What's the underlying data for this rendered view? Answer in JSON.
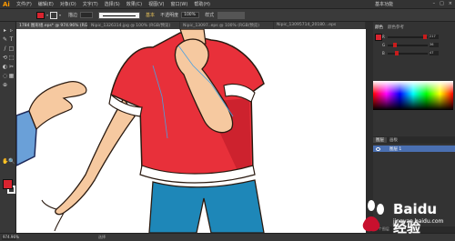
{
  "app": {
    "logo": "Ai"
  },
  "menu": {
    "items": [
      "文件(F)",
      "编辑(E)",
      "对象(O)",
      "文字(T)",
      "选择(S)",
      "效果(C)",
      "视图(V)",
      "窗口(W)",
      "帮助(H)"
    ]
  },
  "workspace": {
    "label": "基本功能"
  },
  "window_buttons": [
    "–",
    "□",
    "×"
  ],
  "control": {
    "fill_color": "#d9242f",
    "stroke_label": "描边",
    "stroke_value": "",
    "brush_label": "基本",
    "opacity_label": "不透明度",
    "opacity_value": "100%",
    "style_label": "样式"
  },
  "tabs": [
    {
      "label": "1784 图形组.eps* @ 974.96% (RGB/预览)",
      "active": true
    },
    {
      "label": "Nipic_1326314.jpg @ 100% (RGB/预览)",
      "active": false
    },
    {
      "label": "Nipic_13097..eps @ 100% (RGB/预览)",
      "active": false
    },
    {
      "label": "Nipic_13095714_20180...eps",
      "active": false
    }
  ],
  "tools": [
    "▸",
    "▹",
    "✎",
    "T",
    "/",
    "□",
    "⟲",
    "⬚",
    "◐",
    "✂",
    "◌",
    "▦",
    "⊕",
    "✋",
    "🔍"
  ],
  "toolbar_colors": {
    "fill": "#d9242f",
    "stroke": "none"
  },
  "panels": {
    "color_tabs": [
      "颜色",
      "颜色参考"
    ],
    "layer_tabs": [
      "图层",
      "画板"
    ],
    "layer_name": "图层 1",
    "color_values": [
      {
        "channel": "R",
        "value": "217"
      },
      {
        "channel": "G",
        "value": "36"
      },
      {
        "channel": "B",
        "value": "47"
      }
    ],
    "layers_footer": "1 个图层"
  },
  "status": {
    "zoom": "974.96%",
    "text": "选择"
  },
  "watermark": {
    "text": "Baidu 经验",
    "url": "jingyan.baidu.com"
  }
}
